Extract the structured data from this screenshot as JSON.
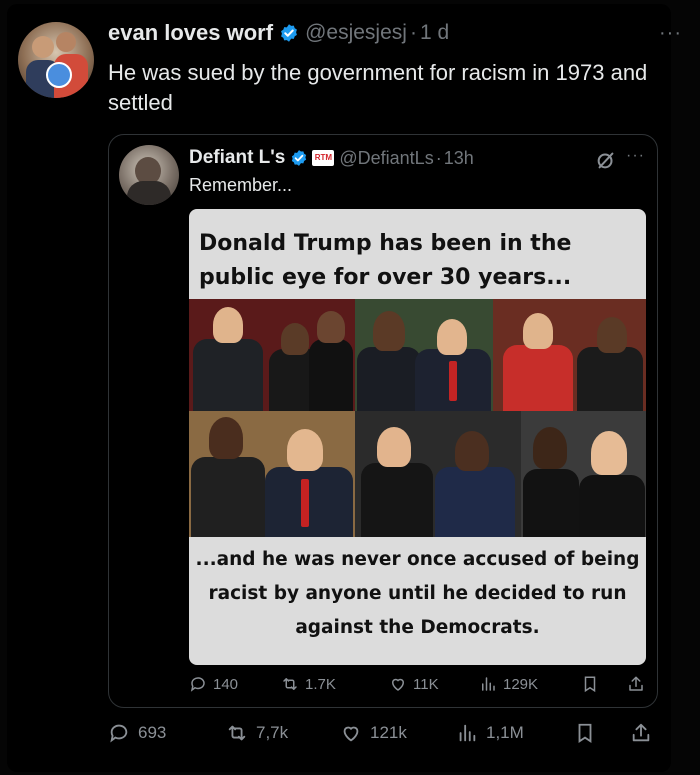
{
  "tweet": {
    "author_name": "evan loves worf",
    "handle": "@esjesjesj",
    "separator": "·",
    "time": "1 d",
    "more": "···",
    "text": "He was sued by the government for racism in 1973 and settled",
    "stats": {
      "replies": "693",
      "retweets": "7,7k",
      "likes": "121k",
      "views": "1,1M"
    }
  },
  "quote": {
    "author_name": "Defiant L's",
    "badge": "RTM",
    "handle": "@DefiantLs",
    "separator": "·",
    "time": "13h",
    "more": "···",
    "text": "Remember...",
    "meme_top": "Donald Trump has been in the public eye for over 30 years...",
    "meme_bottom": "...and he was never once accused of being racist by anyone until he decided to run against the Democrats.",
    "stats": {
      "replies": "140",
      "retweets": "1.7K",
      "likes": "11K",
      "views": "129K"
    }
  },
  "colors": {
    "background": "#000000",
    "verified": "#1d9bf0",
    "muted": "#71767b",
    "text": "#e7e9ea"
  },
  "icons": [
    "verified-icon",
    "more-icon",
    "grok-icon",
    "reply-icon",
    "retweet-icon",
    "like-icon",
    "views-icon",
    "bookmark-icon",
    "share-icon"
  ]
}
